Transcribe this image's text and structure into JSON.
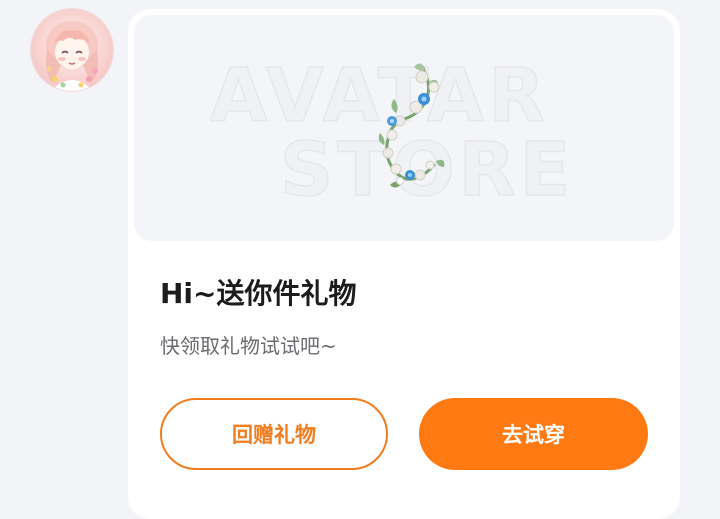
{
  "gift_card": {
    "banner": {
      "watermark_line1": "AVATAR",
      "watermark_line2": "STORE"
    },
    "title": "Hi~送你件礼物",
    "subtitle": "快领取礼物试试吧~",
    "return_gift_label": "回赠礼物",
    "try_on_label": "去试穿"
  },
  "colors": {
    "accent": "#ff7a12",
    "accent_outline": "#f07d1f",
    "page_bg": "#f3f4f8",
    "card_bg": "#ffffff",
    "title_text": "#1c1c1e",
    "subtitle_text": "#6b6b70"
  },
  "icons": {
    "avatar": "anime-girl-avatar",
    "gift": "flower-vine-decoration"
  }
}
